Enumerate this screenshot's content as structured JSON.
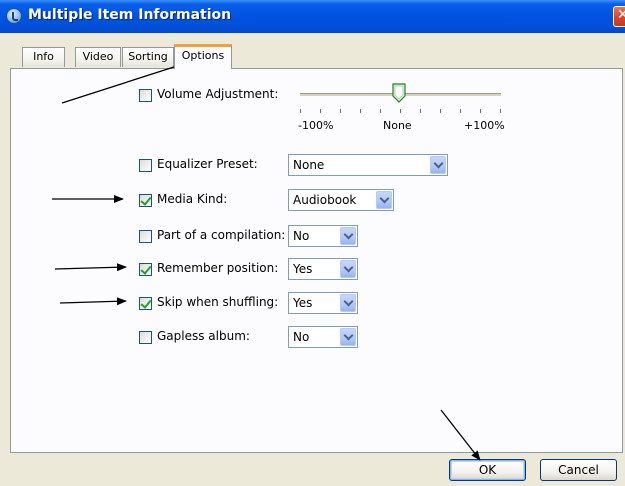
{
  "window": {
    "title": "Multiple Item Information",
    "close_icon": "close-icon"
  },
  "tabs": [
    {
      "label": "Info",
      "active": false
    },
    {
      "label": "Video",
      "active": false
    },
    {
      "label": "Sorting",
      "active": false
    },
    {
      "label": "Options",
      "active": true
    }
  ],
  "options": {
    "volume_adjustment": {
      "label": "Volume Adjustment:",
      "checked": false,
      "min_label": "-100%",
      "mid_label": "None",
      "max_label": "+100%",
      "value_fraction": 0.5
    },
    "equalizer_preset": {
      "label": "Equalizer Preset:",
      "checked": false,
      "value": "None"
    },
    "media_kind": {
      "label": "Media Kind:",
      "checked": true,
      "value": "Audiobook"
    },
    "compilation": {
      "label": "Part of a compilation:",
      "checked": false,
      "value": "No"
    },
    "remember_position": {
      "label": "Remember position:",
      "checked": true,
      "value": "Yes"
    },
    "skip_shuffling": {
      "label": "Skip when shuffling:",
      "checked": true,
      "value": "Yes"
    },
    "gapless_album": {
      "label": "Gapless album:",
      "checked": false,
      "value": "No"
    }
  },
  "buttons": {
    "ok": "OK",
    "cancel": "Cancel"
  },
  "colors": {
    "title_bar": "#0054e3",
    "active_tab_accent": "#f2a23a",
    "check_mark": "#21a121",
    "dialog_bg": "#ece9d8"
  }
}
